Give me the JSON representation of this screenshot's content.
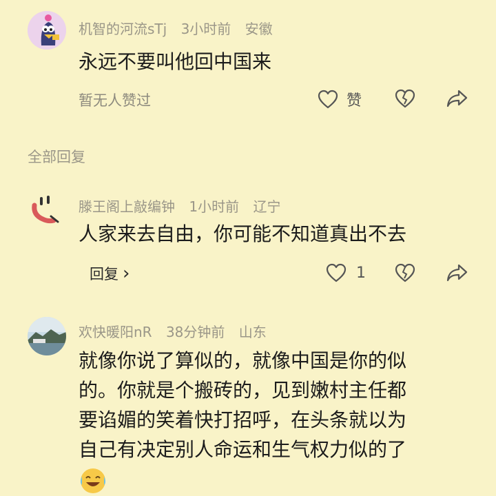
{
  "comment1": {
    "username": "机智的河流sTj",
    "time": "3小时前",
    "location": "安徽",
    "text": "永远不要叫他回中国来",
    "no_likes": "暂无人赞过",
    "like_label": "赞"
  },
  "section_label": "全部回复",
  "reply1": {
    "username": "滕王阁上敲编钟",
    "time": "1小时前",
    "location": "辽宁",
    "text": "人家来去自由，你可能不知道真出不去",
    "reply_label": "回复",
    "reply_chevron": "›",
    "like_count": "1"
  },
  "reply2": {
    "username": "欢快暖阳nR",
    "time": "38分钟前",
    "location": "山东",
    "text_lines": [
      "就像你说了算似的，就像中国是你的似",
      "的。你就是个搬砖的，见到嫩村主任都",
      "要谄媚的笑着快打招呼，在头条就以为",
      "自己有决定别人命运和生气权力似的了"
    ],
    "emoji": "crying-laughing-emoji"
  },
  "colors": {
    "background": "#f9f3c8",
    "meta_text": "#9a9688",
    "body_text": "#1c1c1c",
    "icon": "#555555"
  }
}
